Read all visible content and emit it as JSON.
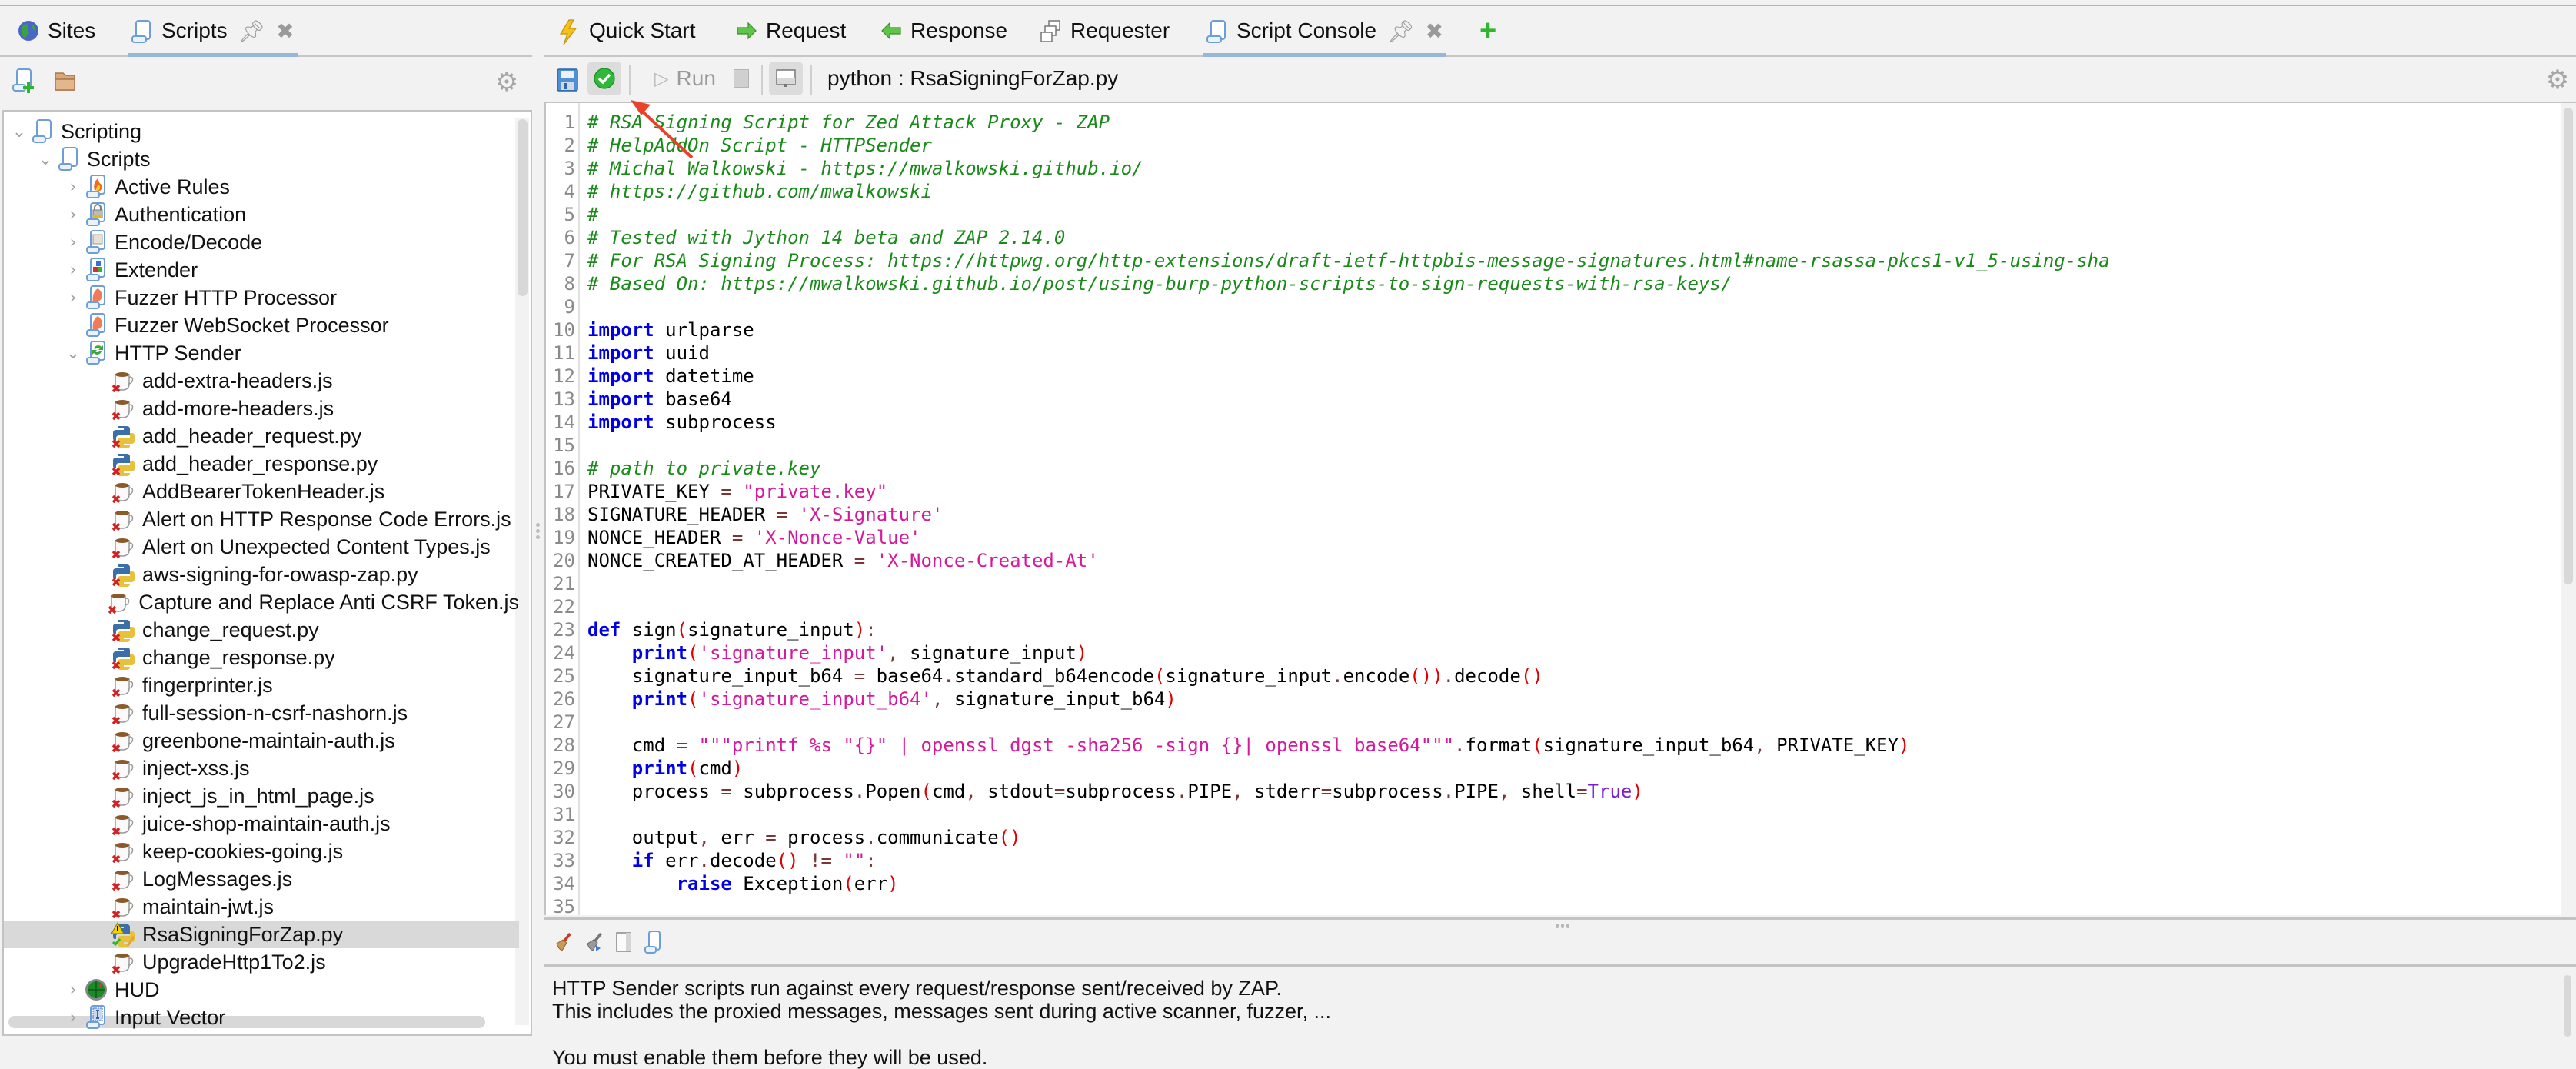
{
  "left_panel": {
    "tabs": [
      {
        "label": "Sites",
        "icon": "globe-icon",
        "active": false
      },
      {
        "label": "Scripts",
        "icon": "script-scroll-icon",
        "active": true
      }
    ],
    "toolbar": {
      "new_script": "new-script-icon",
      "load_script": "open-folder-icon",
      "options": "gear-icon"
    },
    "tree": [
      {
        "label": "Scripting",
        "level": 0,
        "expander": "expanded",
        "icon": "scroll-icon"
      },
      {
        "label": "Scripts",
        "level": 1,
        "expander": "expanded",
        "icon": "scroll-icon"
      },
      {
        "label": "Active Rules",
        "level": 2,
        "expander": "collapsed",
        "icon": "flame-scroll-icon"
      },
      {
        "label": "Authentication",
        "level": 2,
        "expander": "collapsed",
        "icon": "lock-scroll-icon"
      },
      {
        "label": "Encode/Decode",
        "level": 2,
        "expander": "collapsed",
        "icon": "encode-scroll-icon"
      },
      {
        "label": "Extender",
        "level": 2,
        "expander": "collapsed",
        "icon": "extender-scroll-icon"
      },
      {
        "label": "Fuzzer HTTP Processor",
        "level": 2,
        "expander": "collapsed",
        "icon": "fuzzer-scroll-icon"
      },
      {
        "label": "Fuzzer WebSocket Processor",
        "level": 2,
        "expander": "none",
        "icon": "fuzzer-scroll-icon"
      },
      {
        "label": "HTTP Sender",
        "level": 2,
        "expander": "expanded",
        "icon": "http-sender-scroll-icon"
      },
      {
        "label": "add-extra-headers.js",
        "level": 3,
        "expander": "none",
        "icon": "js-disabled-icon"
      },
      {
        "label": "add-more-headers.js",
        "level": 3,
        "expander": "none",
        "icon": "js-disabled-icon"
      },
      {
        "label": "add_header_request.py",
        "level": 3,
        "expander": "none",
        "icon": "python-disabled-icon"
      },
      {
        "label": "add_header_response.py",
        "level": 3,
        "expander": "none",
        "icon": "python-disabled-icon"
      },
      {
        "label": "AddBearerTokenHeader.js",
        "level": 3,
        "expander": "none",
        "icon": "js-disabled-icon"
      },
      {
        "label": "Alert on HTTP Response Code Errors.js",
        "level": 3,
        "expander": "none",
        "icon": "js-disabled-icon"
      },
      {
        "label": "Alert on Unexpected Content Types.js",
        "level": 3,
        "expander": "none",
        "icon": "js-disabled-icon"
      },
      {
        "label": "aws-signing-for-owasp-zap.py",
        "level": 3,
        "expander": "none",
        "icon": "python-disabled-icon"
      },
      {
        "label": "Capture and Replace Anti CSRF Token.js",
        "level": 3,
        "expander": "none",
        "icon": "js-disabled-icon"
      },
      {
        "label": "change_request.py",
        "level": 3,
        "expander": "none",
        "icon": "python-disabled-icon"
      },
      {
        "label": "change_response.py",
        "level": 3,
        "expander": "none",
        "icon": "python-disabled-icon"
      },
      {
        "label": "fingerprinter.js",
        "level": 3,
        "expander": "none",
        "icon": "js-disabled-icon"
      },
      {
        "label": "full-session-n-csrf-nashorn.js",
        "level": 3,
        "expander": "none",
        "icon": "js-disabled-icon"
      },
      {
        "label": "greenbone-maintain-auth.js",
        "level": 3,
        "expander": "none",
        "icon": "js-disabled-icon"
      },
      {
        "label": "inject-xss.js",
        "level": 3,
        "expander": "none",
        "icon": "js-disabled-icon"
      },
      {
        "label": "inject_js_in_html_page.js",
        "level": 3,
        "expander": "none",
        "icon": "js-disabled-icon"
      },
      {
        "label": "juice-shop-maintain-auth.js",
        "level": 3,
        "expander": "none",
        "icon": "js-disabled-icon"
      },
      {
        "label": "keep-cookies-going.js",
        "level": 3,
        "expander": "none",
        "icon": "js-disabled-icon"
      },
      {
        "label": "LogMessages.js",
        "level": 3,
        "expander": "none",
        "icon": "js-disabled-icon"
      },
      {
        "label": "maintain-jwt.js",
        "level": 3,
        "expander": "none",
        "icon": "js-disabled-icon"
      },
      {
        "label": "RsaSigningForZap.py",
        "level": 3,
        "expander": "none",
        "icon": "python-warning-enabled-icon",
        "selected": true
      },
      {
        "label": "UpgradeHttp1To2.js",
        "level": 3,
        "expander": "none",
        "icon": "js-disabled-icon"
      },
      {
        "label": "HUD",
        "level": 2,
        "expander": "collapsed",
        "icon": "hud-globe-icon"
      },
      {
        "label": "Input Vector",
        "level": 2,
        "expander": "collapsed",
        "icon": "input-vector-scroll-icon"
      }
    ]
  },
  "right_panel": {
    "tabs": [
      {
        "label": "Quick Start",
        "icon": "lightning-icon"
      },
      {
        "label": "Request",
        "icon": "arrow-right-icon"
      },
      {
        "label": "Response",
        "icon": "arrow-left-icon"
      },
      {
        "label": "Requester",
        "icon": "requester-icon"
      },
      {
        "label": "Script Console",
        "icon": "script-scroll-icon",
        "active": true
      }
    ],
    "add_tab": "plus-icon",
    "toolbar": {
      "save": "save-icon",
      "enable": "check-circle-icon",
      "run_label": "Run",
      "stop": "stop-icon",
      "screen": "screen-icon",
      "script_name": "python : RsaSigningForZap.py",
      "options": "gear-icon"
    },
    "editor": {
      "lines": [
        [
          [
            "c",
            "# RSA Signing Script for Zed Attack Proxy - ZAP"
          ]
        ],
        [
          [
            "c",
            "# HelpAddOn Script - HTTPSender"
          ]
        ],
        [
          [
            "c",
            "# Michal Walkowski - https://mwalkowski.github.io/"
          ]
        ],
        [
          [
            "c",
            "# https://github.com/mwalkowski"
          ]
        ],
        [
          [
            "c",
            "#"
          ]
        ],
        [
          [
            "c",
            "# Tested with Jython 14 beta and ZAP 2.14.0"
          ]
        ],
        [
          [
            "c",
            "# For RSA Signing Process: https://httpwg.org/http-extensions/draft-ietf-httpbis-message-signatures.html#name-rsassa-pkcs1-v1_5-using-sha"
          ]
        ],
        [
          [
            "c",
            "# Based On: https://mwalkowski.github.io/post/using-burp-python-scripts-to-sign-requests-with-rsa-keys/"
          ]
        ],
        [],
        [
          [
            "k",
            "import"
          ],
          [
            "t",
            " urlparse"
          ]
        ],
        [
          [
            "k",
            "import"
          ],
          [
            "t",
            " uuid"
          ]
        ],
        [
          [
            "k",
            "import"
          ],
          [
            "t",
            " datetime"
          ]
        ],
        [
          [
            "k",
            "import"
          ],
          [
            "t",
            " base64"
          ]
        ],
        [
          [
            "k",
            "import"
          ],
          [
            "t",
            " subprocess"
          ]
        ],
        [],
        [
          [
            "c",
            "# path to private.key"
          ]
        ],
        [
          [
            "t",
            "PRIVATE_KEY "
          ],
          [
            "o",
            "="
          ],
          [
            "t",
            " "
          ],
          [
            "s",
            "\"private.key\""
          ]
        ],
        [
          [
            "t",
            "SIGNATURE_HEADER "
          ],
          [
            "o",
            "="
          ],
          [
            "t",
            " "
          ],
          [
            "s",
            "'X-Signature'"
          ]
        ],
        [
          [
            "t",
            "NONCE_HEADER "
          ],
          [
            "o",
            "="
          ],
          [
            "t",
            " "
          ],
          [
            "s",
            "'X-Nonce-Value'"
          ]
        ],
        [
          [
            "t",
            "NONCE_CREATED_AT_HEADER "
          ],
          [
            "o",
            "="
          ],
          [
            "t",
            " "
          ],
          [
            "s",
            "'X-Nonce-Created-At'"
          ]
        ],
        [],
        [],
        [
          [
            "k",
            "def"
          ],
          [
            "t",
            " sign"
          ],
          [
            "p",
            "("
          ],
          [
            "t",
            "signature_input"
          ],
          [
            "p",
            ")"
          ],
          [
            "o",
            ":"
          ]
        ],
        [
          [
            "t",
            "    "
          ],
          [
            "k",
            "print"
          ],
          [
            "p",
            "("
          ],
          [
            "s",
            "'signature_input'"
          ],
          [
            "o",
            ","
          ],
          [
            "t",
            " signature_input"
          ],
          [
            "p",
            ")"
          ]
        ],
        [
          [
            "t",
            "    signature_input_b64 "
          ],
          [
            "o",
            "="
          ],
          [
            "t",
            " base64"
          ],
          [
            "o",
            "."
          ],
          [
            "t",
            "standard_b64encode"
          ],
          [
            "p",
            "("
          ],
          [
            "t",
            "signature_input"
          ],
          [
            "o",
            "."
          ],
          [
            "t",
            "encode"
          ],
          [
            "p",
            "())"
          ],
          [
            "o",
            "."
          ],
          [
            "t",
            "decode"
          ],
          [
            "p",
            "()"
          ]
        ],
        [
          [
            "t",
            "    "
          ],
          [
            "k",
            "print"
          ],
          [
            "p",
            "("
          ],
          [
            "s",
            "'signature_input_b64'"
          ],
          [
            "o",
            ","
          ],
          [
            "t",
            " signature_input_b64"
          ],
          [
            "p",
            ")"
          ]
        ],
        [],
        [
          [
            "t",
            "    cmd "
          ],
          [
            "o",
            "="
          ],
          [
            "t",
            " "
          ],
          [
            "s",
            "\"\"\"printf %s \"{}\" | openssl dgst -sha256 -sign {}| openssl base64\"\"\""
          ],
          [
            "o",
            "."
          ],
          [
            "t",
            "format"
          ],
          [
            "p",
            "("
          ],
          [
            "t",
            "signature_input_b64"
          ],
          [
            "o",
            ","
          ],
          [
            "t",
            " PRIVATE_KEY"
          ],
          [
            "p",
            ")"
          ]
        ],
        [
          [
            "t",
            "    "
          ],
          [
            "k",
            "print"
          ],
          [
            "p",
            "("
          ],
          [
            "t",
            "cmd"
          ],
          [
            "p",
            ")"
          ]
        ],
        [
          [
            "t",
            "    process "
          ],
          [
            "o",
            "="
          ],
          [
            "t",
            " subprocess"
          ],
          [
            "o",
            "."
          ],
          [
            "t",
            "Popen"
          ],
          [
            "p",
            "("
          ],
          [
            "t",
            "cmd"
          ],
          [
            "o",
            ","
          ],
          [
            "t",
            " stdout"
          ],
          [
            "o",
            "="
          ],
          [
            "t",
            "subprocess"
          ],
          [
            "o",
            "."
          ],
          [
            "t",
            "PIPE"
          ],
          [
            "o",
            ","
          ],
          [
            "t",
            " stderr"
          ],
          [
            "o",
            "="
          ],
          [
            "t",
            "subprocess"
          ],
          [
            "o",
            "."
          ],
          [
            "t",
            "PIPE"
          ],
          [
            "o",
            ","
          ],
          [
            "t",
            " shell"
          ],
          [
            "o",
            "="
          ],
          [
            "b",
            "True"
          ],
          [
            "p",
            ")"
          ]
        ],
        [],
        [
          [
            "t",
            "    output"
          ],
          [
            "o",
            ","
          ],
          [
            "t",
            " err "
          ],
          [
            "o",
            "="
          ],
          [
            "t",
            " process"
          ],
          [
            "o",
            "."
          ],
          [
            "t",
            "communicate"
          ],
          [
            "p",
            "()"
          ]
        ],
        [
          [
            "t",
            "    "
          ],
          [
            "k",
            "if"
          ],
          [
            "t",
            " err"
          ],
          [
            "o",
            "."
          ],
          [
            "t",
            "decode"
          ],
          [
            "p",
            "()"
          ],
          [
            "t",
            " "
          ],
          [
            "o",
            "!="
          ],
          [
            "t",
            " "
          ],
          [
            "s",
            "\"\""
          ],
          [
            "o",
            ":"
          ]
        ],
        [
          [
            "t",
            "        "
          ],
          [
            "k",
            "raise"
          ],
          [
            "t",
            " Exception"
          ],
          [
            "p",
            "("
          ],
          [
            "t",
            "err"
          ],
          [
            "p",
            ")"
          ]
        ],
        []
      ]
    },
    "output_toolbar": [
      "clear-broom-icon",
      "clear-on-run-broom-icon",
      "split-view-icon",
      "script-scroll-icon"
    ],
    "output_lines": [
      "HTTP Sender scripts run against every request/response sent/received by ZAP.",
      "This includes the proxied messages, messages sent during active scanner, fuzzer, ...",
      "",
      "You must enable them before they will be used."
    ]
  },
  "annotation": {
    "type": "red-arrow",
    "points_to": "enable-script-button",
    "color": "#e8432a"
  },
  "colors": {
    "comment": "#1a8a1a",
    "keyword": "#0000e6",
    "string": "#d4199a",
    "operator": "#7a3535",
    "paren": "#e00000",
    "literal": "#7a1fd0",
    "tab_underline": "#97b7d9",
    "selection": "#d9d9d9"
  }
}
